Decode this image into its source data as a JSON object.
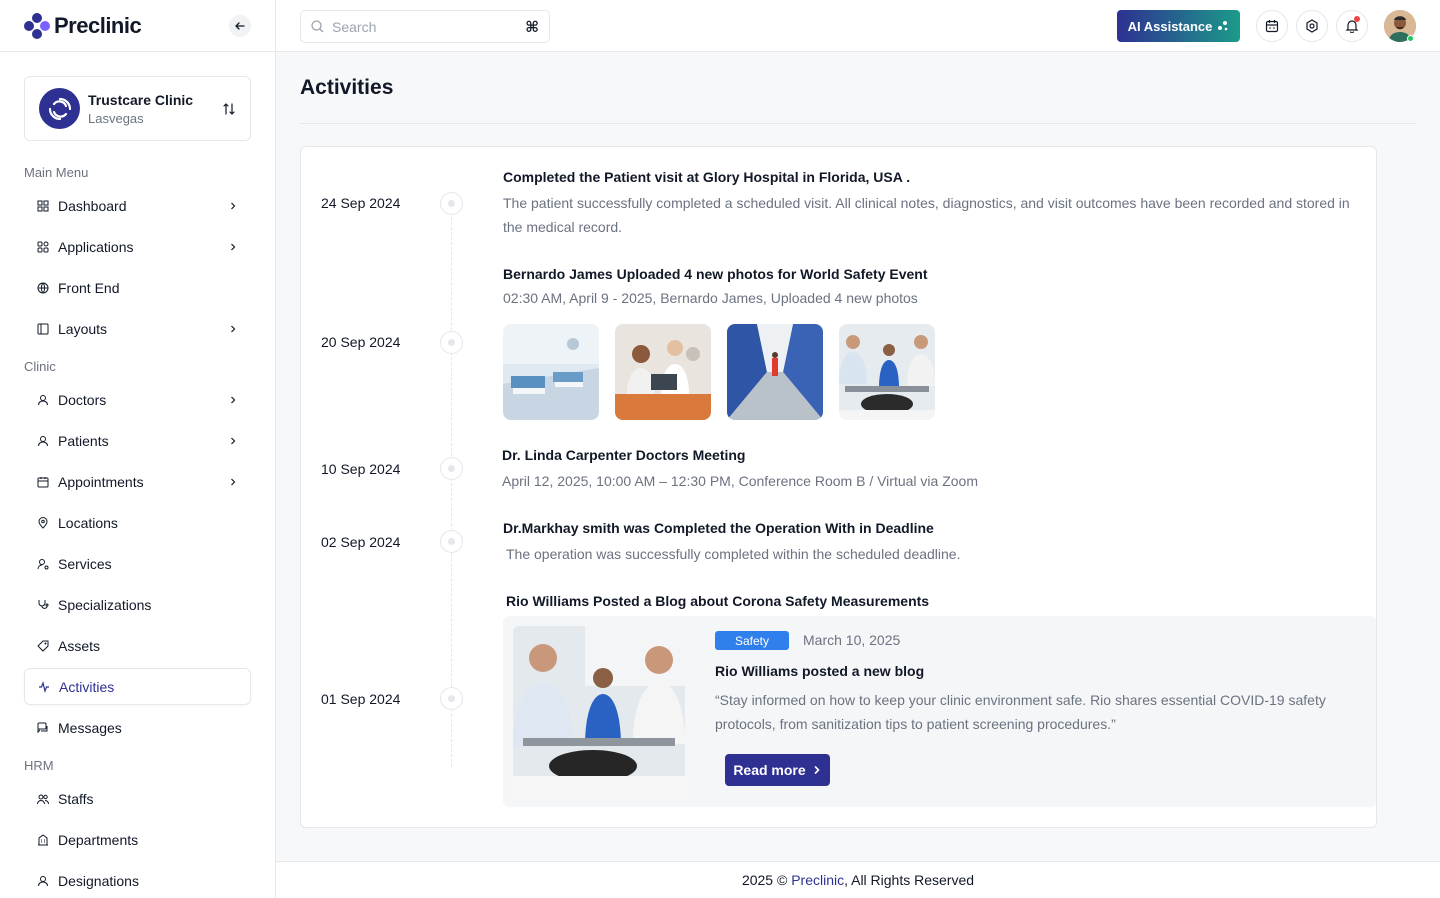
{
  "brand": {
    "name": "Preclinic"
  },
  "clinic": {
    "name": "Trustcare Clinic",
    "location": "Lasvegas"
  },
  "sidebar": {
    "main_heading": "Main Menu",
    "main_items": [
      "Dashboard",
      "Applications",
      "Front End",
      "Layouts"
    ],
    "clinic_heading": "Clinic",
    "clinic_items": [
      "Doctors",
      "Patients",
      "Appointments",
      "Locations",
      "Services",
      "Specializations",
      "Assets",
      "Activities",
      "Messages"
    ],
    "hrm_heading": "HRM",
    "hrm_items": [
      "Staffs",
      "Departments",
      "Designations"
    ]
  },
  "topbar": {
    "search_placeholder": "Search",
    "shortcut": "⌘",
    "ai_label": "AI Assistance"
  },
  "page": {
    "title": "Activities"
  },
  "timeline": {
    "dates": [
      "24 Sep 2024",
      "20 Sep 2024",
      "10 Sep 2024",
      "02 Sep 2024",
      "01 Sep 2024"
    ],
    "events": [
      {
        "title": "Completed the Patient visit at Glory Hospital in Florida, USA .",
        "text": "The patient successfully completed a scheduled visit. All clinical notes, diagnostics, and visit outcomes have been recorded and stored in the medical record."
      },
      {
        "title": "Bernardo James Uploaded 4 new photos for World Safety Event",
        "text": "02:30 AM, April 9 - 2025, Bernardo James, Uploaded 4 new photos"
      },
      {
        "title": "Dr. Linda Carpenter Doctors Meeting",
        "text": "April 12, 2025, 10:00 AM – 12:30 PM, Conference Room B / Virtual via Zoom"
      },
      {
        "title": "Dr.Markhay smith was Completed the Operation With in Deadline",
        "text": "The operation was successfully completed within the scheduled deadline."
      },
      {
        "title": "Rio Williams Posted a Blog about Corona Safety Measurements",
        "text": ""
      }
    ]
  },
  "blog": {
    "badge": "Safety",
    "date": "March 10, 2025",
    "title": "Rio Williams posted a new blog",
    "text": "“Stay informed on how to keep your clinic environment safe. Rio shares essential COVID-19 safety protocols, from sanitization tips to patient screening procedures.”",
    "cta": "Read more"
  },
  "footer": {
    "prefix": "2025 © ",
    "brand": "Preclinic",
    "suffix": ", All Rights Reserved"
  },
  "colors": {
    "primary": "#2e3192",
    "teal": "#1b9b8a",
    "badge": "#2f80ed",
    "border": "#e5e7eb"
  }
}
